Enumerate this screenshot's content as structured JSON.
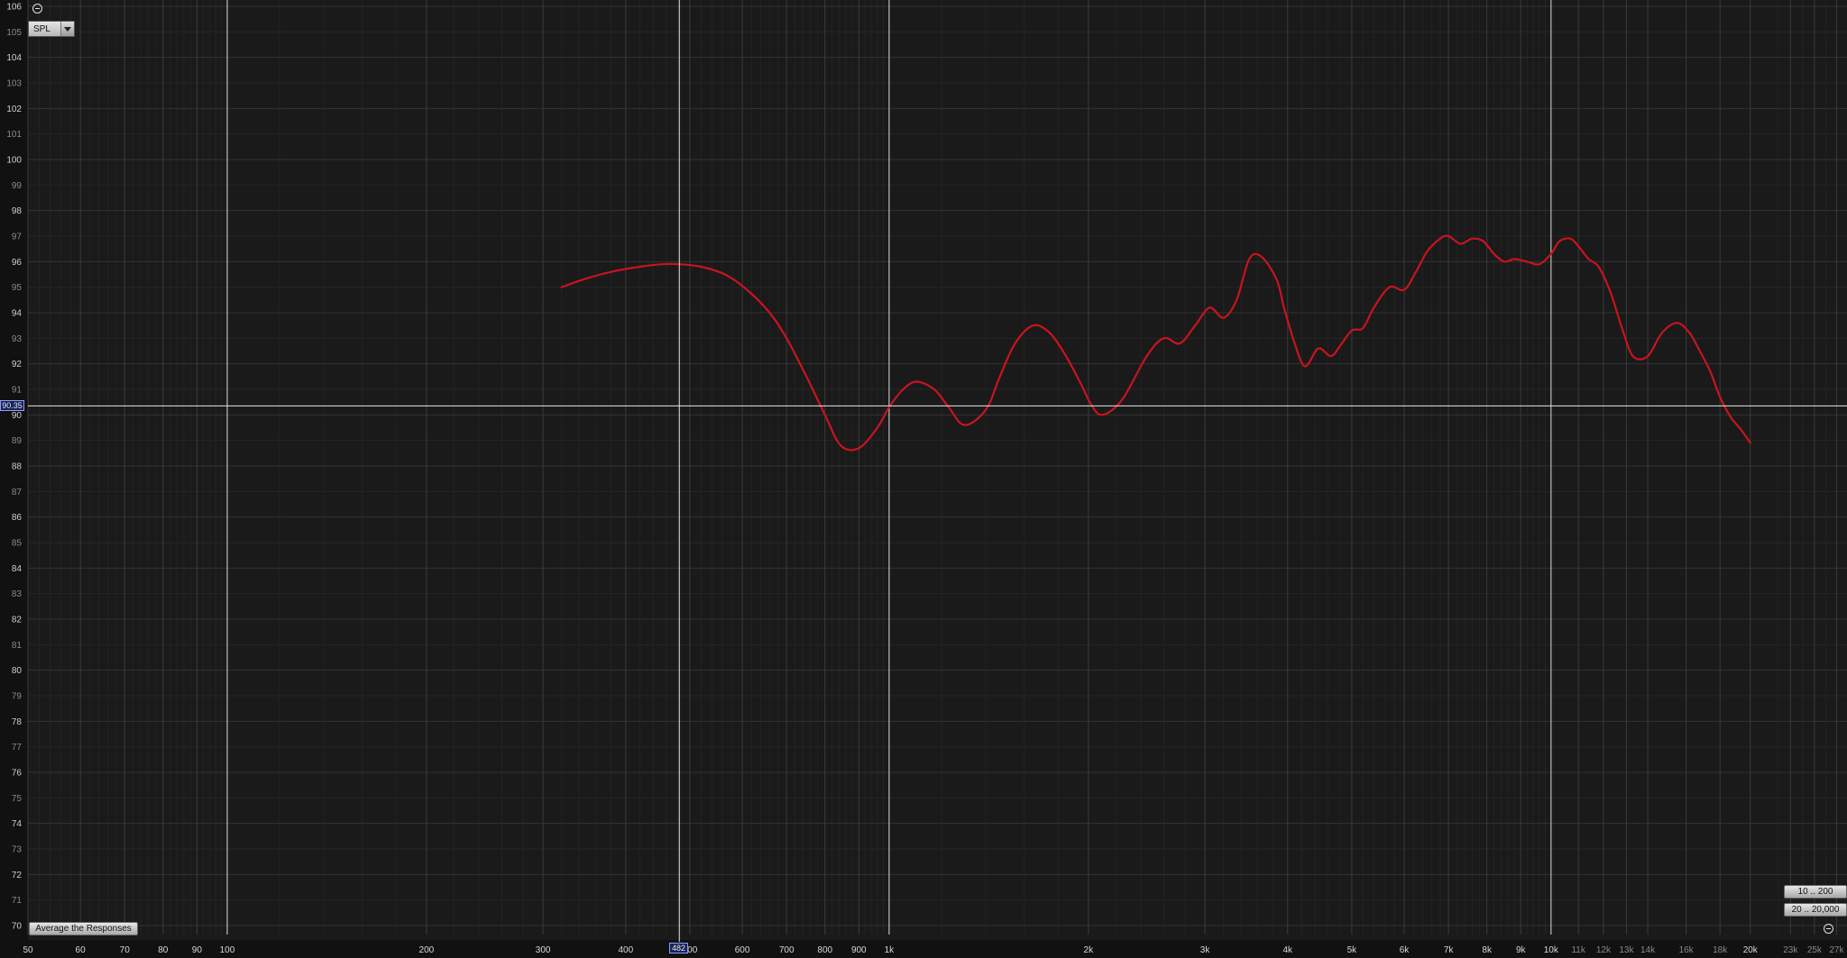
{
  "controls": {
    "mode_select": "SPL",
    "average_button": "Average the Responses",
    "range_button_1": "10 .. 200",
    "range_button_2": "20 .. 20,000"
  },
  "cursor": {
    "freq": 482,
    "spl": 90.35,
    "freq_label": "482",
    "spl_label": "90.35"
  },
  "chart_data": {
    "type": "line",
    "title": "",
    "xlabel": "",
    "ylabel": "",
    "x_scale": "log",
    "xlim": [
      50,
      28000
    ],
    "ylim": [
      70,
      106
    ],
    "grid": true,
    "x_ticks": [
      {
        "v": 50,
        "t": "50",
        "major": true
      },
      {
        "v": 60,
        "t": "60",
        "major": true
      },
      {
        "v": 70,
        "t": "70",
        "major": true
      },
      {
        "v": 80,
        "t": "80",
        "major": true
      },
      {
        "v": 90,
        "t": "90",
        "major": true
      },
      {
        "v": 100,
        "t": "100",
        "major": true
      },
      {
        "v": 200,
        "t": "200",
        "major": true
      },
      {
        "v": 300,
        "t": "300",
        "major": true
      },
      {
        "v": 400,
        "t": "400",
        "major": true
      },
      {
        "v": 500,
        "t": "500",
        "major": true
      },
      {
        "v": 600,
        "t": "600",
        "major": true
      },
      {
        "v": 700,
        "t": "700",
        "major": true
      },
      {
        "v": 800,
        "t": "800",
        "major": true
      },
      {
        "v": 900,
        "t": "900",
        "major": true
      },
      {
        "v": 1000,
        "t": "1k",
        "major": true
      },
      {
        "v": 2000,
        "t": "2k",
        "major": true
      },
      {
        "v": 3000,
        "t": "3k",
        "major": true
      },
      {
        "v": 4000,
        "t": "4k",
        "major": true
      },
      {
        "v": 5000,
        "t": "5k",
        "major": true
      },
      {
        "v": 6000,
        "t": "6k",
        "major": true
      },
      {
        "v": 7000,
        "t": "7k",
        "major": true
      },
      {
        "v": 8000,
        "t": "8k",
        "major": true
      },
      {
        "v": 9000,
        "t": "9k",
        "major": true
      },
      {
        "v": 10000,
        "t": "10k",
        "major": true
      },
      {
        "v": 11000,
        "t": "11k",
        "major": false
      },
      {
        "v": 12000,
        "t": "12k",
        "major": false
      },
      {
        "v": 13000,
        "t": "13k",
        "major": false
      },
      {
        "v": 14000,
        "t": "14k",
        "major": false
      },
      {
        "v": 16000,
        "t": "16k",
        "major": false
      },
      {
        "v": 18000,
        "t": "18k",
        "major": false
      },
      {
        "v": 20000,
        "t": "20k",
        "major": true
      },
      {
        "v": 23000,
        "t": "23k",
        "major": false
      },
      {
        "v": 25000,
        "t": "25k",
        "major": false
      },
      {
        "v": 27000,
        "t": "27k",
        "major": false
      }
    ],
    "y_ticks_major": [
      70,
      72,
      74,
      76,
      78,
      80,
      82,
      84,
      86,
      88,
      90,
      92,
      94,
      96,
      98,
      100,
      102,
      104,
      106
    ],
    "y_ticks_minor": [
      71,
      73,
      75,
      77,
      79,
      81,
      83,
      85,
      87,
      89,
      91,
      93,
      95,
      97,
      99,
      101,
      103,
      105
    ],
    "series": [
      {
        "color": "#c8141e",
        "x": [
          320,
          345,
          380,
          420,
          455,
          482,
          520,
          565,
          610,
          660,
          700,
          750,
          800,
          845,
          900,
          960,
          1000,
          1050,
          1100,
          1170,
          1230,
          1300,
          1400,
          1470,
          1550,
          1650,
          1750,
          1850,
          1950,
          2020,
          2100,
          2250,
          2450,
          2600,
          2750,
          2900,
          3050,
          3200,
          3350,
          3500,
          3650,
          3850,
          3950,
          4100,
          4250,
          4450,
          4650,
          4800,
          5000,
          5200,
          5400,
          5700,
          6000,
          6250,
          6500,
          6800,
          7000,
          7300,
          7600,
          7900,
          8200,
          8500,
          8800,
          9200,
          9600,
          10000,
          10300,
          10700,
          11000,
          11400,
          11800,
          12300,
          12800,
          13300,
          14000,
          14700,
          15500,
          16200,
          16700,
          17400,
          18000,
          18700,
          19400,
          20000
        ],
        "y": [
          95.0,
          95.3,
          95.6,
          95.8,
          95.9,
          95.9,
          95.8,
          95.5,
          94.9,
          94.0,
          93.0,
          91.5,
          90.0,
          88.8,
          88.7,
          89.5,
          90.3,
          91.0,
          91.3,
          91.0,
          90.3,
          89.6,
          90.2,
          91.5,
          92.8,
          93.5,
          93.2,
          92.3,
          91.2,
          90.4,
          90.0,
          90.6,
          92.3,
          93.0,
          92.8,
          93.5,
          94.2,
          93.8,
          94.5,
          96.1,
          96.2,
          95.3,
          94.2,
          92.8,
          91.9,
          92.6,
          92.3,
          92.7,
          93.3,
          93.4,
          94.2,
          95.0,
          94.9,
          95.6,
          96.4,
          96.9,
          97.0,
          96.7,
          96.9,
          96.8,
          96.3,
          96.0,
          96.1,
          96.0,
          95.9,
          96.3,
          96.8,
          96.9,
          96.6,
          96.1,
          95.8,
          94.8,
          93.4,
          92.3,
          92.3,
          93.2,
          93.6,
          93.2,
          92.6,
          91.7,
          90.7,
          89.9,
          89.4,
          88.9
        ]
      }
    ]
  }
}
